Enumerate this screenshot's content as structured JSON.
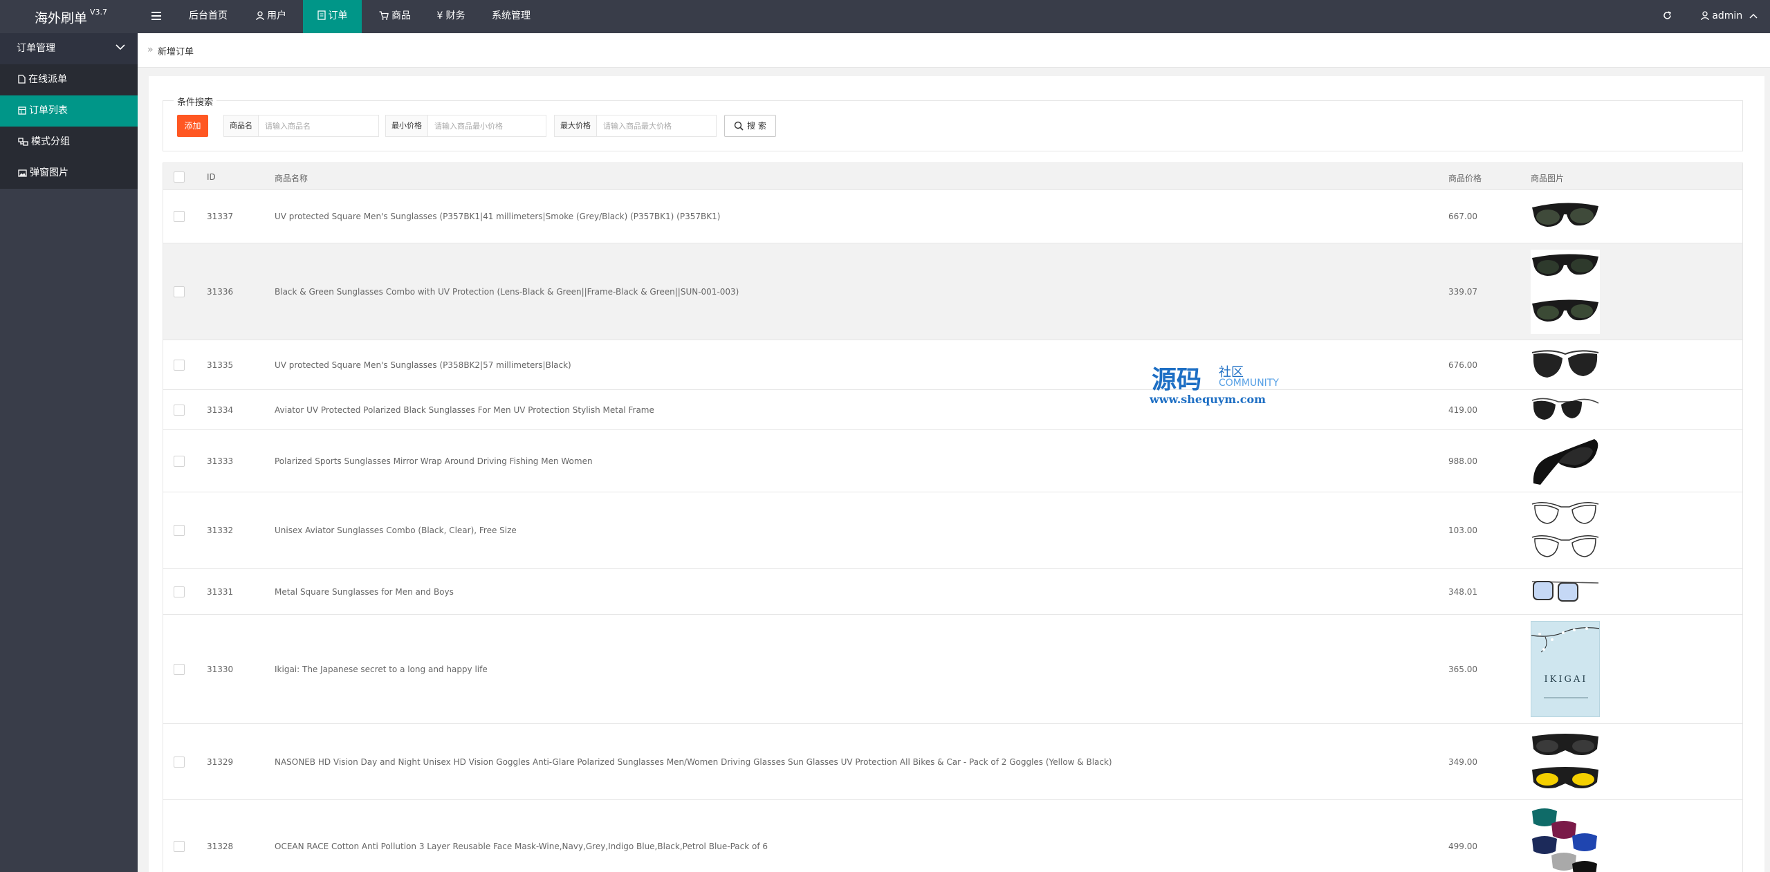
{
  "app": {
    "title": "海外刷单",
    "version": "V3.7"
  },
  "topnav": {
    "menu_icon": "hamburger-icon",
    "items": [
      {
        "label": "后台首页",
        "icon": ""
      },
      {
        "label": "用户",
        "icon": "user-icon"
      },
      {
        "label": "订单",
        "icon": "document-icon",
        "active": true
      },
      {
        "label": "商品",
        "icon": "cart-icon"
      },
      {
        "label": "财务",
        "icon": "yen-icon"
      },
      {
        "label": "系统管理",
        "icon": ""
      }
    ],
    "user": "admin",
    "colors": {
      "bar": "#393d49",
      "active": "#009688"
    }
  },
  "sidebar": {
    "group": "订单管理",
    "items": [
      {
        "label": "在线派单",
        "icon": "file-icon"
      },
      {
        "label": "订单列表",
        "icon": "list-icon",
        "active": true
      },
      {
        "label": "模式分组",
        "icon": "group-icon"
      },
      {
        "label": "弹窗图片",
        "icon": "image-icon"
      }
    ]
  },
  "breadcrumb": {
    "current": "新增订单"
  },
  "search": {
    "legend": "条件搜索",
    "add_label": "添加",
    "name_label": "商品名",
    "name_placeholder": "请输入商品名",
    "min_label": "最小价格",
    "min_placeholder": "请输入商品最小价格",
    "max_label": "最大价格",
    "max_placeholder": "请输入商品最大价格",
    "search_label": "搜 索",
    "colors": {
      "add": "#ff5722"
    }
  },
  "table": {
    "columns": [
      "ID",
      "商品名称",
      "商品价格",
      "商品图片"
    ],
    "rows": [
      {
        "id": "31337",
        "name": "UV protected Square Men's Sunglasses (P357BK1|41 millimeters|Smoke (Grey/Black) (P357BK1) (P357BK1)",
        "price": "667.00",
        "image": "sunglasses-wayfarer-icon"
      },
      {
        "id": "31336",
        "name": "Black & Green Sunglasses Combo with UV Protection (Lens-Black & Green||Frame-Black & Green||SUN-001-003)",
        "price": "339.07",
        "image": "sunglasses-combo-icon"
      },
      {
        "id": "31335",
        "name": "UV protected Square Men's Sunglasses (P358BK2|57 millimeters|Black)",
        "price": "676.00",
        "image": "sunglasses-aviator-icon"
      },
      {
        "id": "31334",
        "name": "Aviator UV Protected Polarized Black Sunglasses For Men UV Protection Stylish Metal Frame",
        "price": "419.00",
        "image": "sunglasses-aviator-icon"
      },
      {
        "id": "31333",
        "name": "Polarized Sports Sunglasses Mirror Wrap Around Driving Fishing Men Women",
        "price": "988.00",
        "image": "sunglasses-sport-icon"
      },
      {
        "id": "31332",
        "name": "Unisex Aviator Sunglasses Combo (Black, Clear), Free Size",
        "price": "103.00",
        "image": "sunglasses-clear-combo-icon"
      },
      {
        "id": "31331",
        "name": "Metal Square Sunglasses for Men and Boys",
        "price": "348.01",
        "image": "sunglasses-blue-square-icon"
      },
      {
        "id": "31330",
        "name": "Ikigai: The Japanese secret to a long and happy life",
        "price": "365.00",
        "image": "book-cover-icon",
        "image_text": "IKIGAI"
      },
      {
        "id": "31329",
        "name": "NASONEB HD Vision Day and Night Unisex HD Vision Goggles Anti-Glare Polarized Sunglasses Men/Women Driving Glasses Sun Glasses UV Protection All Bikes & Car - Pack of 2 Goggles (Yellow & Black)",
        "price": "349.00",
        "image": "goggles-yellow-black-icon"
      },
      {
        "id": "31328",
        "name": "OCEAN RACE Cotton Anti Pollution 3 Layer Reusable Face Mask-Wine,Navy,Grey,Indigo Blue,Black,Petrol Blue-Pack of 6",
        "price": "499.00",
        "image": "face-masks-icon"
      }
    ]
  },
  "watermark": {
    "title": "源码",
    "sub": "社区",
    "brand": "COMMUNITY",
    "url": "www.shequym.com"
  }
}
